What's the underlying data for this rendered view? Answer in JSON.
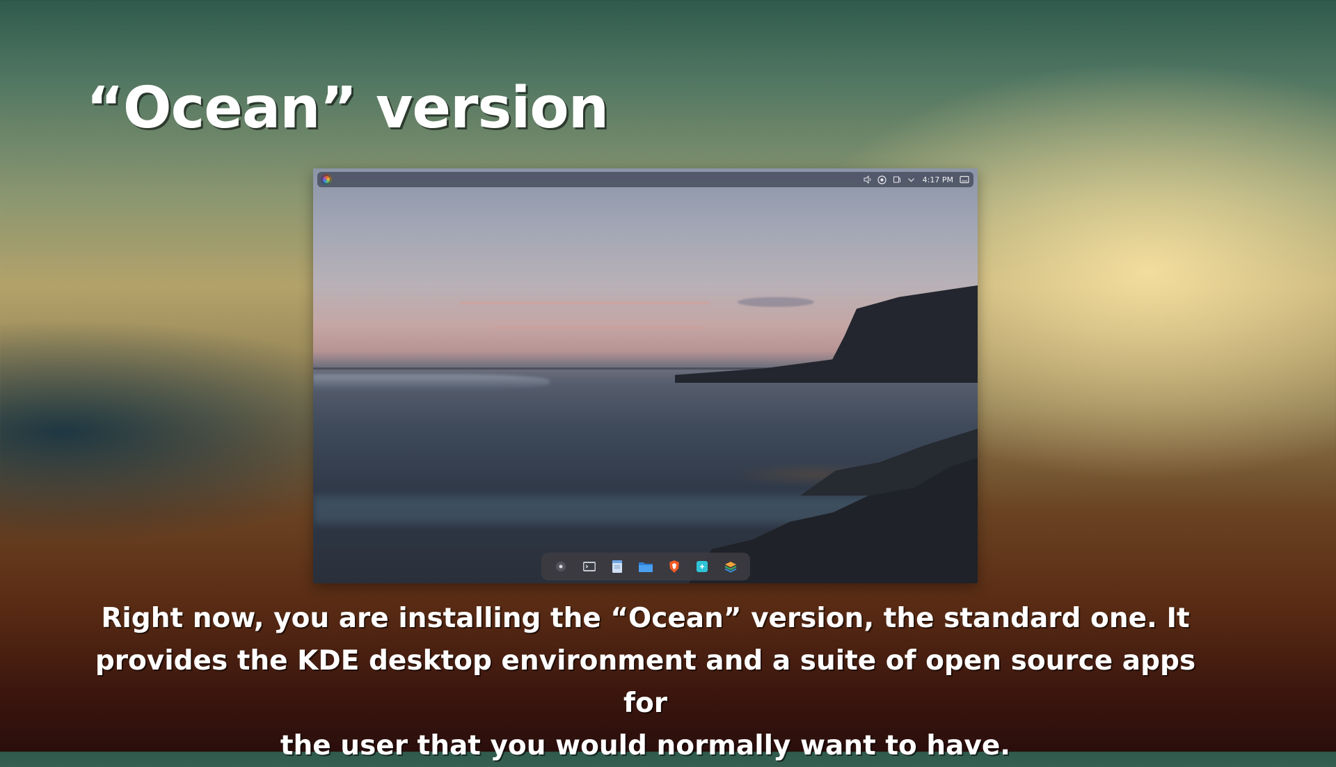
{
  "slide": {
    "title": "“Ocean” version",
    "caption": "Right now, you are installing the “Ocean” version, the standard one. It\nprovides the KDE desktop environment and a suite of open source apps for\nthe user that you would normally want to have."
  },
  "screenshot": {
    "topbar": {
      "app_menu_icon": "app-launcher-icon",
      "tray": {
        "icons": [
          "volume-icon",
          "network-icon",
          "clipboard-icon",
          "chevron-down-icon"
        ],
        "clock": "4:17 PM",
        "show_desktop_icon": "show-desktop-icon"
      }
    },
    "dock": {
      "apps": [
        "overview-icon",
        "terminal-icon",
        "text-editor-icon",
        "file-manager-icon",
        "brave-browser-icon",
        "store-icon",
        "layers-icon"
      ]
    }
  },
  "colors": {
    "text": "#ffffff",
    "panel": "#464c5c",
    "dock": "#3e3c42"
  }
}
